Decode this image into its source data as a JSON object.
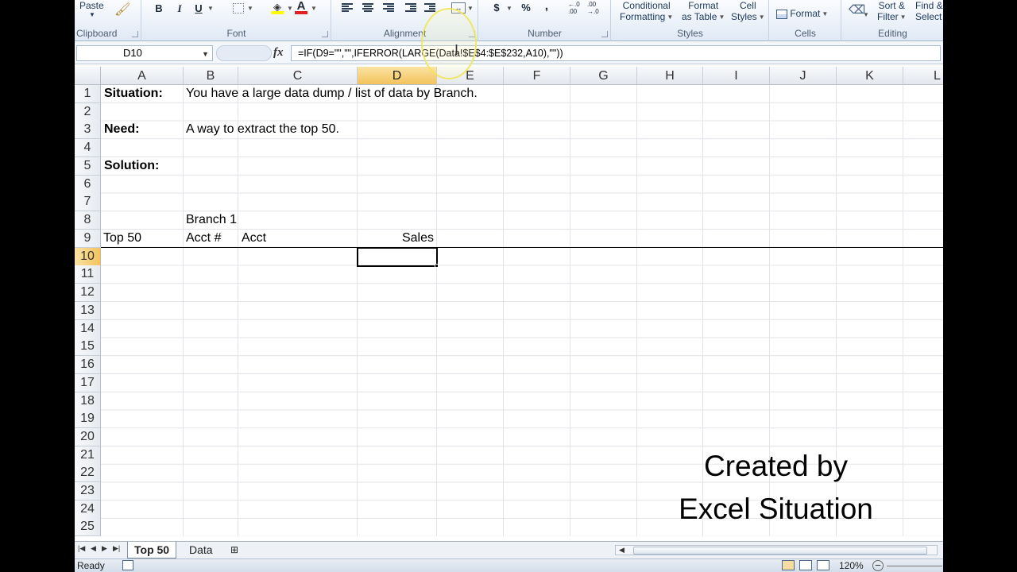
{
  "ribbon": {
    "groups": {
      "clipboard": "Clipboard",
      "font": "Font",
      "alignment": "Alignment",
      "number": "Number",
      "styles": "Styles",
      "cells": "Cells",
      "editing": "Editing"
    },
    "paste_label": "Paste",
    "bold": "B",
    "italic": "I",
    "underline": "U",
    "font_color": "A",
    "currency": "$",
    "percent": "%",
    "comma": ",",
    "conditional_line1": "Conditional",
    "conditional_line2": "Formatting",
    "format_table_line1": "Format",
    "format_table_line2": "as Table",
    "cell_styles_line1": "Cell",
    "cell_styles_line2": "Styles",
    "format_label": "Format",
    "sort_line1": "Sort &",
    "sort_line2": "Filter",
    "find_line1": "Find &",
    "find_line2": "Select"
  },
  "formula_bar": {
    "name_box": "D10",
    "fx": "fx",
    "formula": "=IF(D9=\"\",\"\",IFERROR(LARGE(Data!$E$4:$E$232,A10),\"\"))"
  },
  "columns": [
    "A",
    "B",
    "C",
    "D",
    "E",
    "F",
    "G",
    "H",
    "I",
    "J",
    "K",
    "L"
  ],
  "rows": [
    "1",
    "2",
    "3",
    "4",
    "5",
    "6",
    "7",
    "8",
    "9",
    "10",
    "11",
    "12",
    "13",
    "14",
    "15",
    "16",
    "17",
    "18",
    "19",
    "20",
    "21",
    "22",
    "23",
    "24",
    "25"
  ],
  "cells": {
    "a1": "Situation:",
    "b1": "You have a large data dump / list of data by Branch.",
    "a3": "Need:",
    "b3": "A way to extract the top 50.",
    "a5": "Solution:",
    "b8": "Branch 1",
    "a9": "Top 50",
    "b9": "Acct #",
    "c9": "Acct",
    "d9": "Sales"
  },
  "watermark": {
    "line1": "Created by",
    "line2": "Excel Situation"
  },
  "sheet_tabs": [
    "Top 50",
    "Data"
  ],
  "active_tab": "Top 50",
  "status": {
    "ready": "Ready",
    "zoom": "120%"
  }
}
